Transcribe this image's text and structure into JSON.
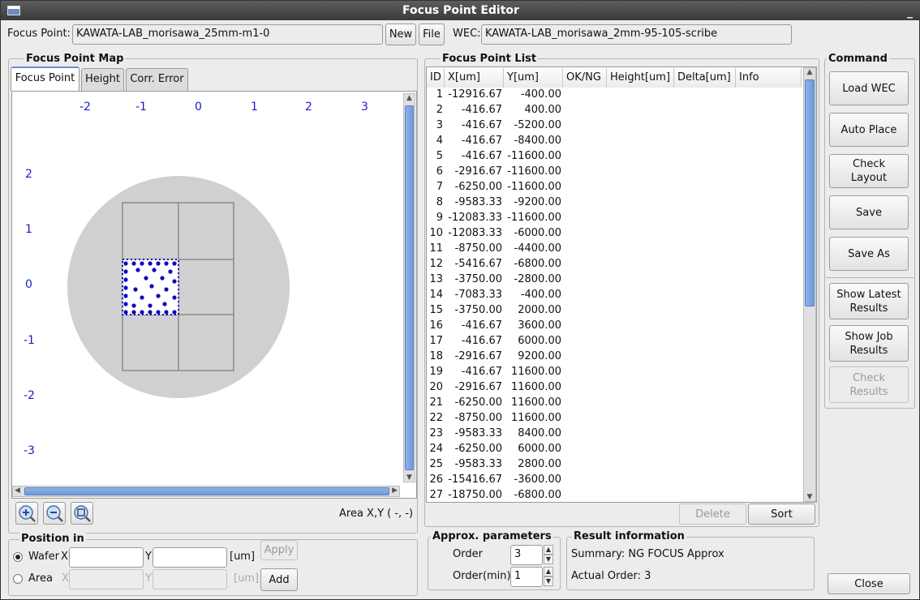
{
  "window": {
    "title": "Focus Point Editor",
    "minimize": "_"
  },
  "top": {
    "focus_point_label": "Focus Point:",
    "focus_point_value": "KAWATA-LAB_morisawa_25mm-m1-0",
    "new": "New",
    "file": "File",
    "wec_label": "WEC:",
    "wec_value": "KAWATA-LAB_morisawa_2mm-95-105-scribe"
  },
  "map": {
    "title": "Focus Point Map",
    "tabs": [
      "Focus Point",
      "Height",
      "Corr. Error"
    ],
    "x_axis": [
      "-2",
      "-1",
      "0",
      "1",
      "2",
      "3"
    ],
    "y_axis": [
      "2",
      "1",
      "0",
      "-1",
      "-2",
      "-3"
    ],
    "area_readout": "Area X,Y ( -, -)",
    "zoom_icons": [
      "zoom-in-icon",
      "zoom-out-icon",
      "zoom-fit-icon"
    ],
    "point_color": "#0a0ab8"
  },
  "position": {
    "title": "Position in",
    "wafer": "Wafer",
    "area": "Area",
    "x": "X",
    "y": "Y",
    "unit": "[um]",
    "apply": "Apply",
    "add": "Add",
    "selected": "Wafer"
  },
  "list": {
    "title": "Focus Point List",
    "columns": [
      "ID",
      "X[um]",
      "Y[um]",
      "OK/NG",
      "Height[um]",
      "Delta[um]",
      "Info"
    ],
    "rows": [
      [
        "1",
        "-12916.67",
        "-400.00"
      ],
      [
        "2",
        "-416.67",
        "400.00"
      ],
      [
        "3",
        "-416.67",
        "-5200.00"
      ],
      [
        "4",
        "-416.67",
        "-8400.00"
      ],
      [
        "5",
        "-416.67",
        "-11600.00"
      ],
      [
        "6",
        "-2916.67",
        "-11600.00"
      ],
      [
        "7",
        "-6250.00",
        "-11600.00"
      ],
      [
        "8",
        "-9583.33",
        "-9200.00"
      ],
      [
        "9",
        "-12083.33",
        "-11600.00"
      ],
      [
        "10",
        "-12083.33",
        "-6000.00"
      ],
      [
        "11",
        "-8750.00",
        "-4400.00"
      ],
      [
        "12",
        "-5416.67",
        "-6800.00"
      ],
      [
        "13",
        "-3750.00",
        "-2800.00"
      ],
      [
        "14",
        "-7083.33",
        "-400.00"
      ],
      [
        "15",
        "-3750.00",
        "2000.00"
      ],
      [
        "16",
        "-416.67",
        "3600.00"
      ],
      [
        "17",
        "-416.67",
        "6000.00"
      ],
      [
        "18",
        "-2916.67",
        "9200.00"
      ],
      [
        "19",
        "-416.67",
        "11600.00"
      ],
      [
        "20",
        "-2916.67",
        "11600.00"
      ],
      [
        "21",
        "-6250.00",
        "11600.00"
      ],
      [
        "22",
        "-8750.00",
        "11600.00"
      ],
      [
        "23",
        "-9583.33",
        "8400.00"
      ],
      [
        "24",
        "-6250.00",
        "6000.00"
      ],
      [
        "25",
        "-9583.33",
        "2800.00"
      ],
      [
        "26",
        "-15416.67",
        "-3600.00"
      ],
      [
        "27",
        "-18750.00",
        "-6800.00"
      ]
    ],
    "delete": "Delete",
    "sort": "Sort"
  },
  "approx": {
    "title": "Approx. parameters",
    "order_label": "Order",
    "order_value": "3",
    "order_min_label": "Order(min)",
    "order_min_value": "1"
  },
  "result": {
    "title": "Result information",
    "summary": "Summary: NG FOCUS Approx",
    "actual_order": "Actual Order: 3"
  },
  "command": {
    "title": "Command",
    "load_wec": "Load WEC",
    "auto_place": "Auto Place",
    "check_layout": "Check Layout",
    "save": "Save",
    "save_as": "Save As",
    "show_latest": "Show Latest Results",
    "show_job": "Show Job Results",
    "check_results": "Check Results",
    "close": "Close"
  }
}
